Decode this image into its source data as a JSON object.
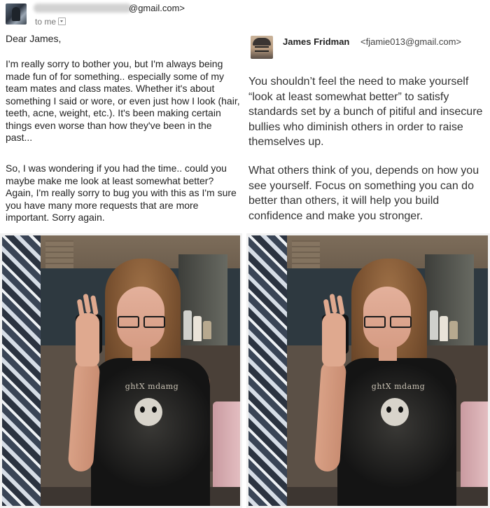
{
  "incoming_email": {
    "sender_domain": "@gmail.com>",
    "to_label": "to me",
    "greeting": "Dear James,",
    "paragraph_1": "I'm really sorry to bother you, but I'm always being made fun of for something.. especially some of my team mates and class mates. Whether it's about something I said or wore, or even just how I look (hair, teeth, acne, weight, etc.). It's been making certain things even worse than how they've been in the past...",
    "paragraph_2": "So, I was wondering if you had the time.. could you maybe make me look at least somewhat better? Again, I'm really sorry to bug you with this as I'm sure you have many more requests that are more important. Sorry again."
  },
  "reply_email": {
    "sender_name": "James Fridman",
    "sender_email": "<fjamie013@gmail.com>",
    "paragraph_1": "You shouldn’t feel the need to make yourself “look at least somewhat better” to satisfy standards set by a bunch of pitiful and insecure bullies who diminish others in order to raise themselves up.",
    "paragraph_2": "What others think of you, depends on how you see yourself. Focus on something you can do better than others, it will help you build confidence and make you stronger."
  },
  "photos": {
    "shirt_print_text": "ghtX mdamg"
  },
  "icons": {
    "sender_avatar": "user-avatar-icon",
    "reply_avatar": "user-avatar-icon",
    "dropdown": "chevron-down-icon"
  }
}
